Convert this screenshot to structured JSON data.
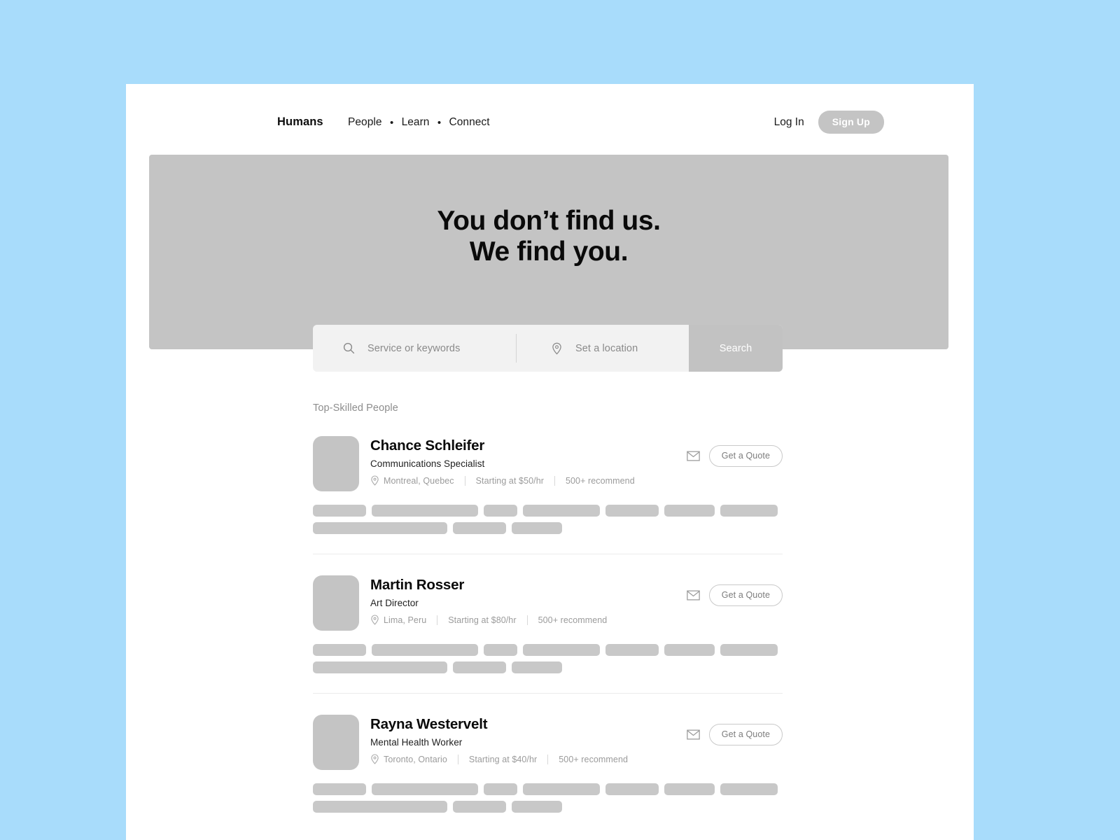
{
  "theme": {
    "page_background": "#a8dcfb",
    "panel_background": "#ffffff",
    "placeholder_gray": "#c4c4c4",
    "skeleton_gray": "#c8c8c8",
    "muted_text": "#9b9b9b"
  },
  "nav": {
    "brand": "Humans",
    "links": [
      {
        "label": "People"
      },
      {
        "label": "Learn"
      },
      {
        "label": "Connect"
      }
    ],
    "separator": "•",
    "login_label": "Log In",
    "signup_label": "Sign Up"
  },
  "hero": {
    "title_line1": "You don’t find us.",
    "title_line2": "We find you."
  },
  "search": {
    "service_placeholder": "Service or keywords",
    "service_value": "",
    "location_placeholder": "Set a location",
    "location_value": "",
    "button_label": "Search",
    "service_icon": "search-icon",
    "location_icon": "map-pin-icon"
  },
  "results": {
    "section_label": "Top-Skilled People",
    "quote_button_label": "Get a Quote",
    "mail_icon": "mail-icon",
    "location_icon": "map-pin-icon",
    "people": [
      {
        "name": "Chance Schleifer",
        "role": "Communications Specialist",
        "location": "Montreal, Quebec",
        "rate": "Starting at $50/hr",
        "recommendations": "500+ recommend",
        "skeleton_rows": [
          [
            76,
            152,
            48,
            110,
            76,
            72,
            82
          ],
          [
            192,
            76,
            72
          ]
        ]
      },
      {
        "name": "Martin Rosser",
        "role": "Art Director",
        "location": "Lima, Peru",
        "rate": "Starting at $80/hr",
        "recommendations": "500+ recommend",
        "skeleton_rows": [
          [
            76,
            152,
            48,
            110,
            76,
            72,
            82
          ],
          [
            192,
            76,
            72
          ]
        ]
      },
      {
        "name": "Rayna Westervelt",
        "role": "Mental Health Worker",
        "location": "Toronto, Ontario",
        "rate": "Starting at $40/hr",
        "recommendations": "500+ recommend",
        "skeleton_rows": [
          [
            76,
            152,
            48,
            110,
            76,
            72,
            82
          ],
          [
            192,
            76,
            72
          ]
        ]
      }
    ]
  }
}
